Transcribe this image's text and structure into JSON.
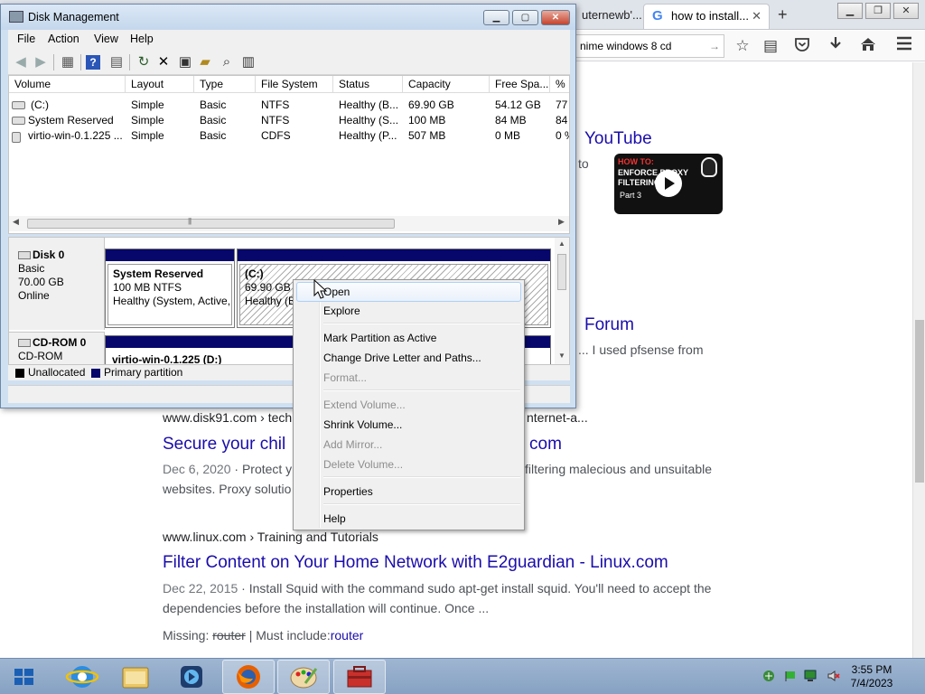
{
  "browser": {
    "tabs": [
      {
        "label": "uternewb'..."
      },
      {
        "label": "how to install...",
        "close": "✕"
      }
    ],
    "new_tab": "+",
    "url": "nime windows 8 cd",
    "url_go": "→",
    "window_buttons": {
      "minimize": "▁",
      "restore": "❐",
      "close": "✕"
    },
    "nav_icons": [
      "star-icon",
      "reading-list-icon",
      "pocket-icon",
      "download-icon",
      "home-icon",
      "menu-icon"
    ],
    "page": {
      "youtube_heading": "YouTube",
      "youtube_snippet": "to",
      "video": {
        "title": "HOW TO:",
        "subtitle": "ENFORCE PROXY\nFILTERING",
        "part": "Part 3"
      },
      "forum_heading": "Forum",
      "forum_snippet": "... I used pfsense from",
      "result1_cite_left": "www.disk91.com › techn",
      "result1_cite_right": "nternet-a...",
      "result1_title_left": "Secure your chil",
      "result1_title_right": "com",
      "result1_date": "Dec 6, 2020",
      "result1_snip_left": " · Protect y",
      "result1_snip_right": "filtering malecious and unsuitable",
      "result1_snip2": "websites. Proxy solutio",
      "result2_cite": "www.linux.com › Training and Tutorials",
      "result2_title": "Filter Content on Your Home Network with E2guardian - Linux.com",
      "result2_date": "Dec 22, 2015",
      "result2_snip1": " · Install Squid with the command sudo apt-get install squid. You'll need to accept the",
      "result2_snip2": "dependencies before the installation will continue. Once ...",
      "missing_label": "Missing: ",
      "missing_word": "router",
      "must_include": " | Must include:",
      "must_word": "router"
    }
  },
  "disk_mgmt": {
    "title": "Disk Management",
    "menu": [
      "File",
      "Action",
      "View",
      "Help"
    ],
    "columns": [
      "Volume",
      "Layout",
      "Type",
      "File System",
      "Status",
      "Capacity",
      "Free Spa...",
      "% F"
    ],
    "rows": [
      [
        "(C:)",
        "Simple",
        "Basic",
        "NTFS",
        "Healthy (B...",
        "69.90 GB",
        "54.12 GB",
        "77"
      ],
      [
        "System Reserved",
        "Simple",
        "Basic",
        "NTFS",
        "Healthy (S...",
        "100 MB",
        "84 MB",
        "84"
      ],
      [
        "virtio-win-0.1.225 ...",
        "Simple",
        "Basic",
        "CDFS",
        "Healthy (P...",
        "507 MB",
        "0 MB",
        "0 %"
      ]
    ],
    "disks": [
      {
        "name": "Disk 0",
        "type": "Basic",
        "size": "70.00 GB",
        "state": "Online"
      },
      {
        "name": "CD-ROM 0",
        "type": "CD-ROM"
      }
    ],
    "partitions": {
      "sysres": {
        "name": "System Reserved",
        "size": "100 MB NTFS",
        "status": "Healthy (System, Active,"
      },
      "c": {
        "name": "(C:)",
        "size": "69.90 GB N",
        "status": "Healthy (B"
      },
      "cd": {
        "name": "virtio-win-0.1.225  (D:)"
      }
    },
    "legend": {
      "unallocated": "Unallocated",
      "primary": "Primary partition"
    },
    "colors": {
      "primary": "#06066b",
      "unallocated": "#000000"
    }
  },
  "context_menu": {
    "items": [
      {
        "label": "Open",
        "enabled": true
      },
      {
        "label": "Explore",
        "enabled": true
      },
      {
        "label": "Mark Partition as Active",
        "enabled": true
      },
      {
        "label": "Change Drive Letter and Paths...",
        "enabled": true
      },
      {
        "label": "Format...",
        "enabled": false
      },
      {
        "label": "Extend Volume...",
        "enabled": false
      },
      {
        "label": "Shrink Volume...",
        "enabled": true
      },
      {
        "label": "Add Mirror...",
        "enabled": false
      },
      {
        "label": "Delete Volume...",
        "enabled": false
      },
      {
        "label": "Properties",
        "enabled": true
      },
      {
        "label": "Help",
        "enabled": true
      }
    ]
  },
  "taskbar": {
    "apps": [
      "internet-explorer-icon",
      "file-explorer-icon",
      "media-center-icon",
      "firefox-icon",
      "paint-icon",
      "toolbox-icon"
    ],
    "clock_time": "3:55 PM",
    "clock_date": "7/4/2023"
  }
}
